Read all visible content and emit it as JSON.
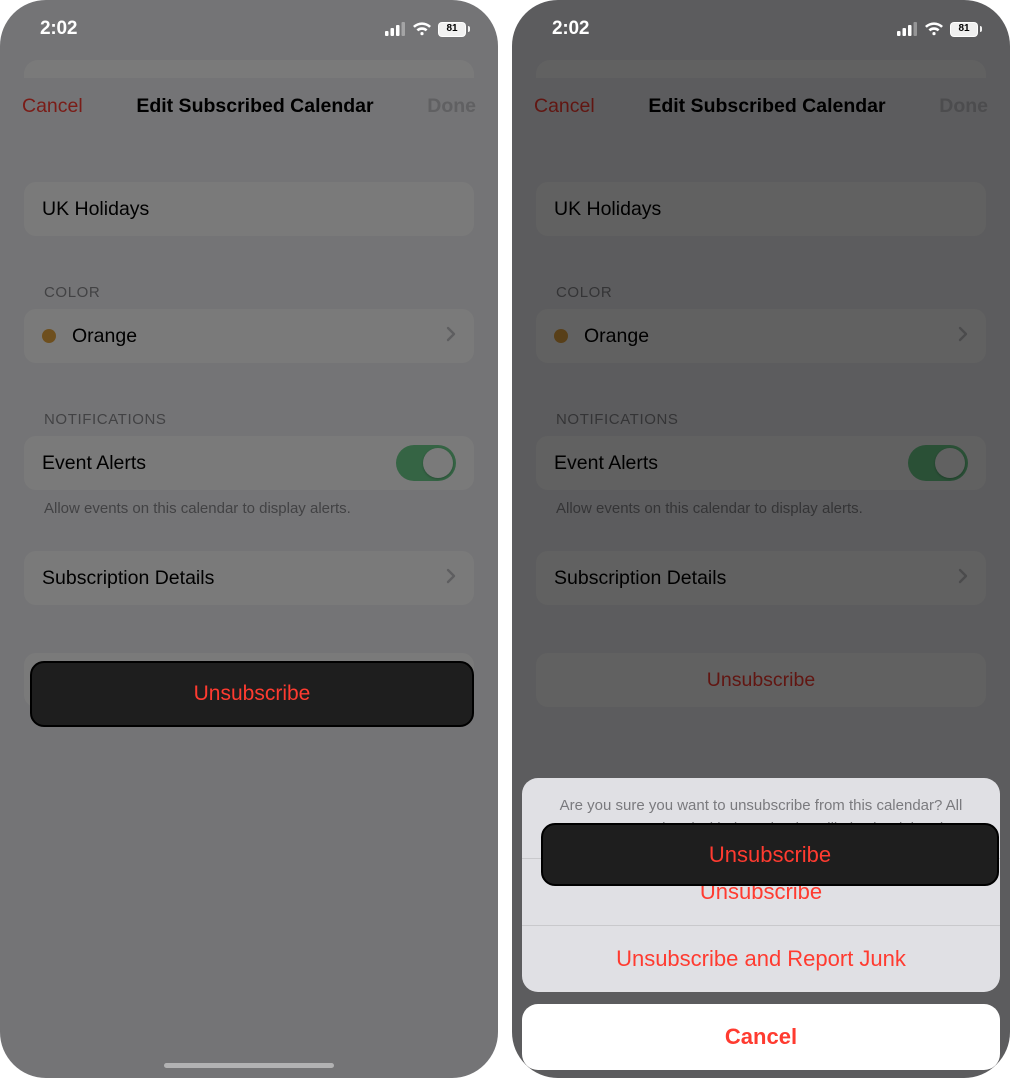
{
  "status": {
    "time": "2:02",
    "battery": "81"
  },
  "sheet": {
    "cancel": "Cancel",
    "title": "Edit Subscribed Calendar",
    "done": "Done",
    "calendar_name": "UK Holidays",
    "color_header": "COLOR",
    "color_name": "Orange",
    "color_hex": "#e6a63f",
    "notifications_header": "NOTIFICATIONS",
    "event_alerts_label": "Event Alerts",
    "event_alerts_on": true,
    "event_alerts_hint": "Allow events on this calendar to display alerts.",
    "subscription_details_label": "Subscription Details",
    "unsubscribe_label": "Unsubscribe"
  },
  "action_sheet": {
    "message": "Are you sure you want to unsubscribe from this calendar? All events associated with the calendar will also be deleted.",
    "unsubscribe": "Unsubscribe",
    "report_junk": "Unsubscribe and Report Junk",
    "cancel": "Cancel"
  },
  "toggle_on_color": "#6fd18f"
}
